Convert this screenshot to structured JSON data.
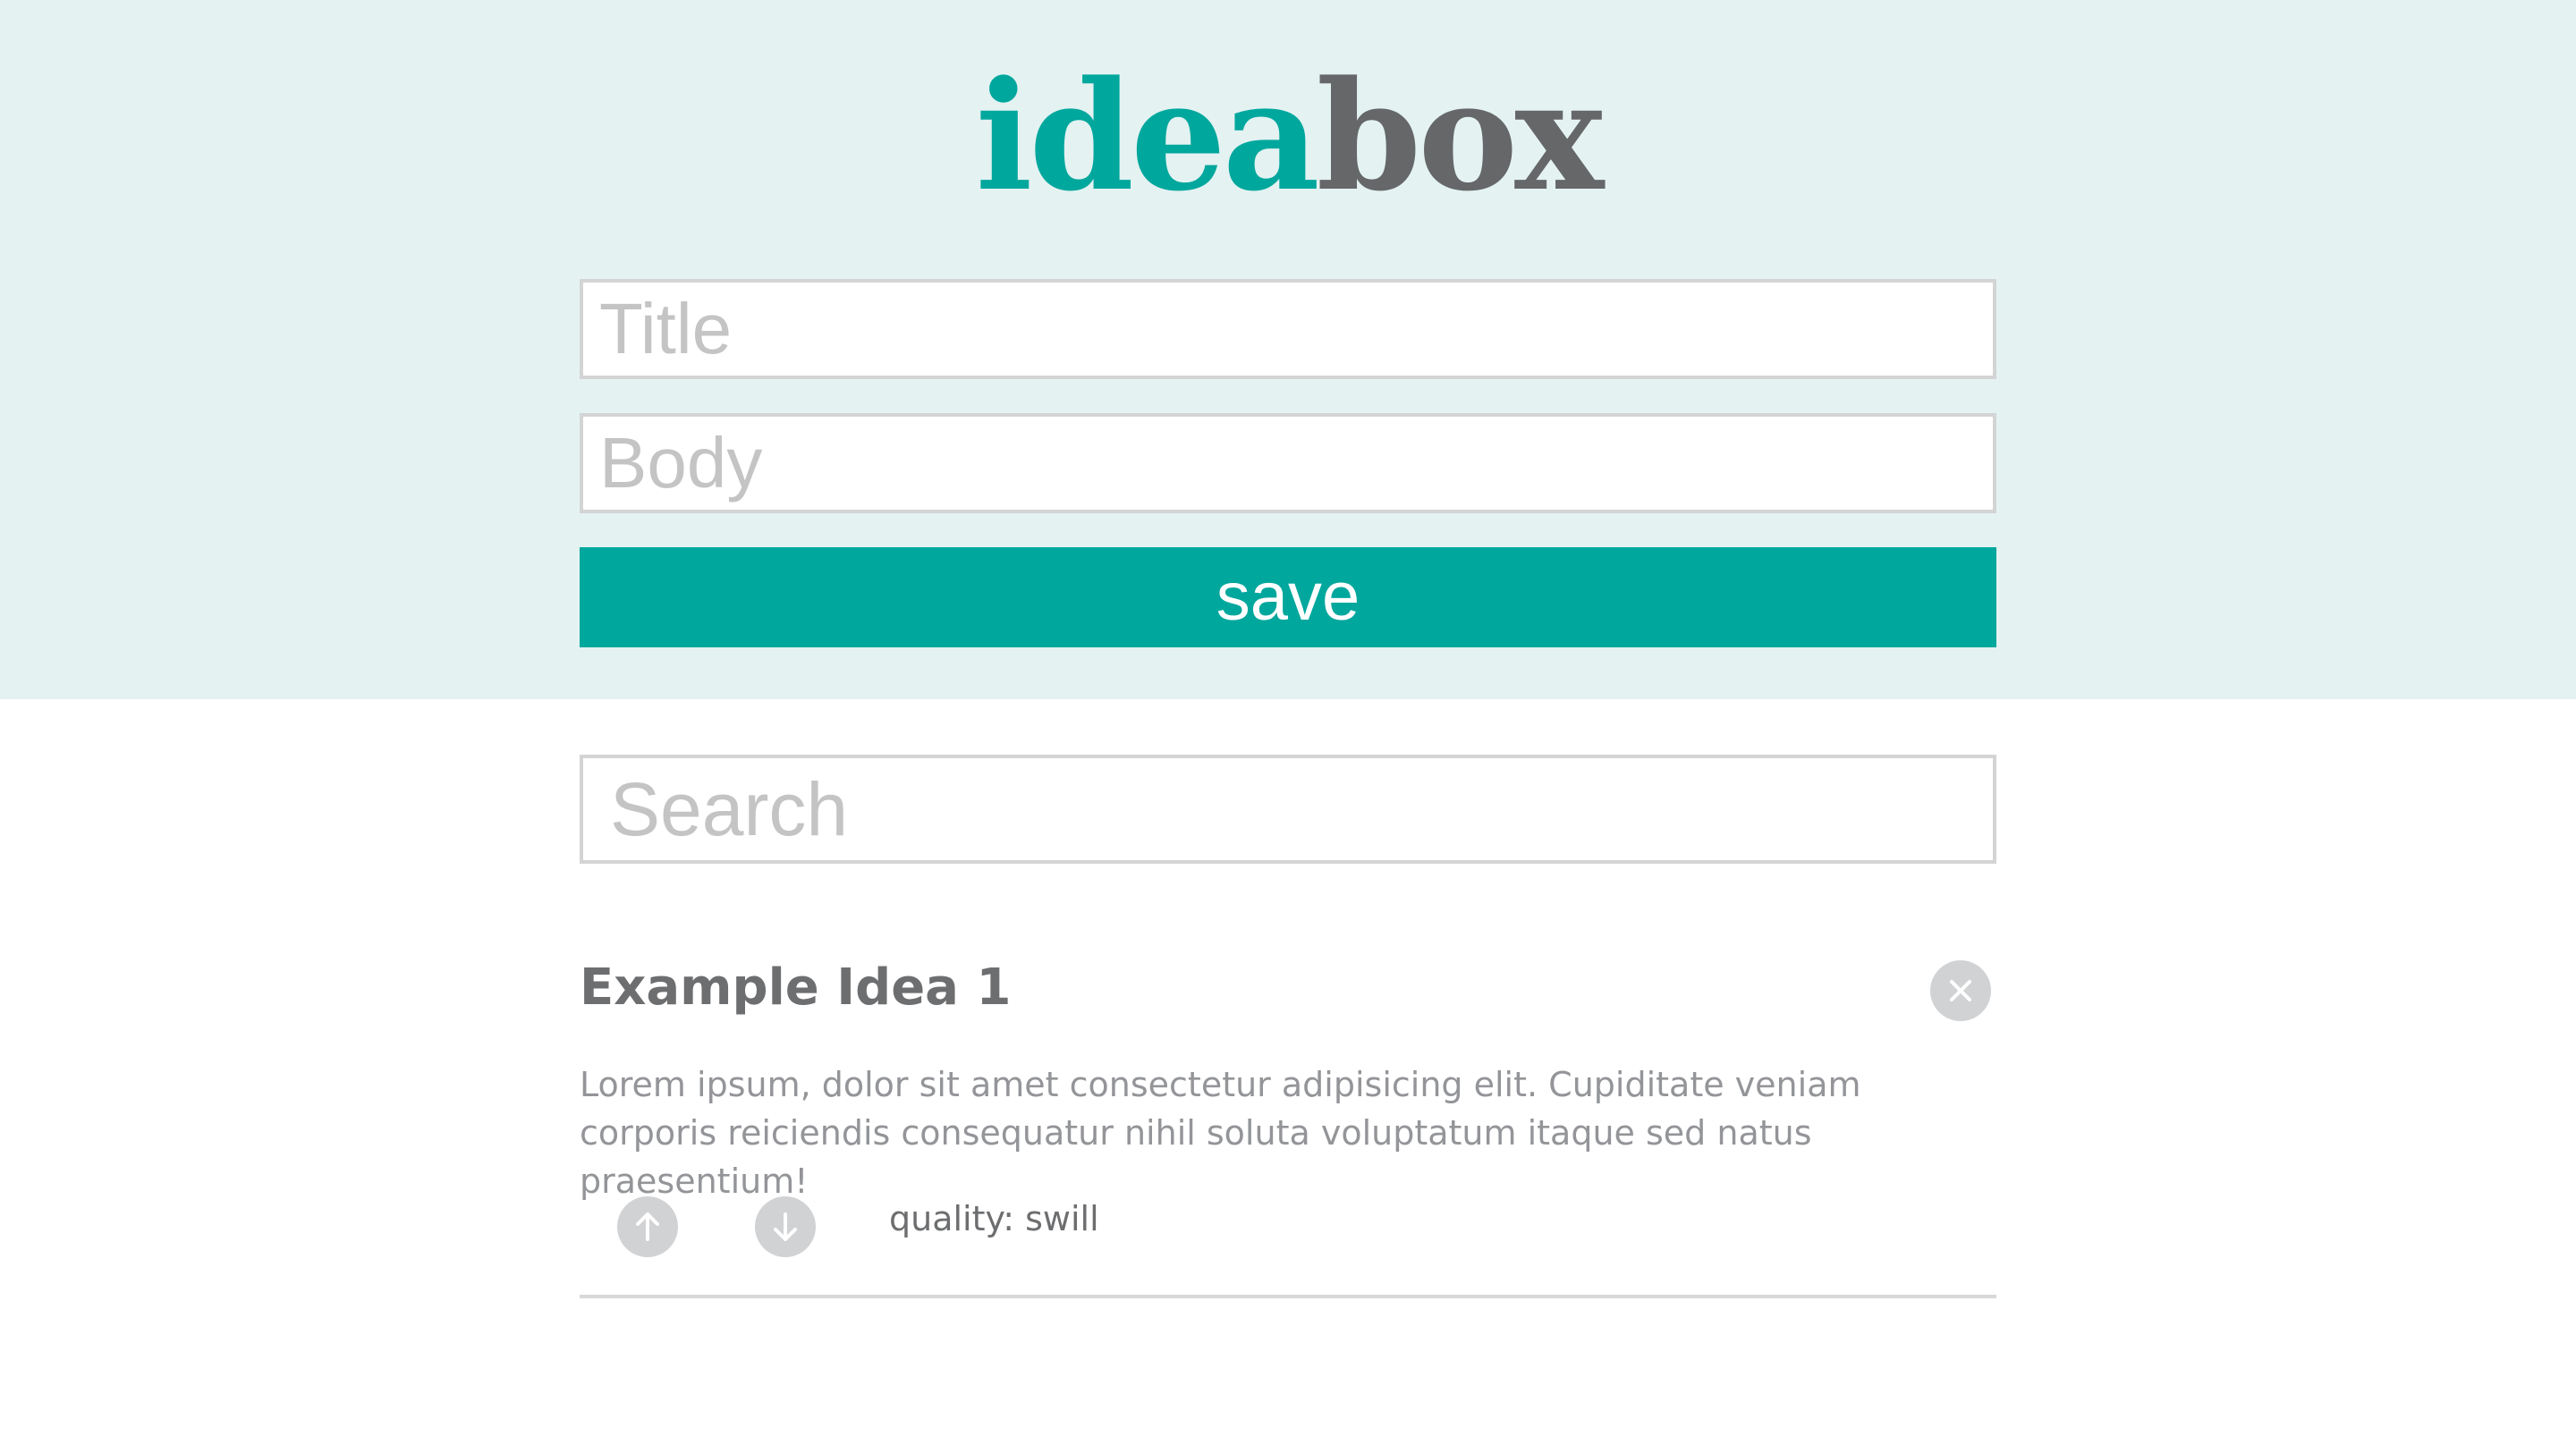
{
  "header": {
    "logo": {
      "part_a": "idea",
      "part_b": "box"
    },
    "title_placeholder": "Title",
    "body_placeholder": "Body",
    "save_label": "save"
  },
  "search": {
    "placeholder": "Search"
  },
  "ideas": [
    {
      "title": "Example Idea 1",
      "body": "Lorem ipsum, dolor sit amet consectetur adipisicing elit. Cupiditate veniam corporis reiciendis consequatur nihil soluta voluptatum itaque sed natus praesentium!",
      "quality_label": "quality: swill"
    }
  ],
  "icons": {
    "delete": "close-icon",
    "upvote": "arrow-up-icon",
    "downvote": "arrow-down-icon"
  },
  "colors": {
    "brand": "#00a79d",
    "logo_gray": "#666769",
    "header_bg": "#e4f2f2",
    "icon_bg": "#d1d2d4"
  }
}
